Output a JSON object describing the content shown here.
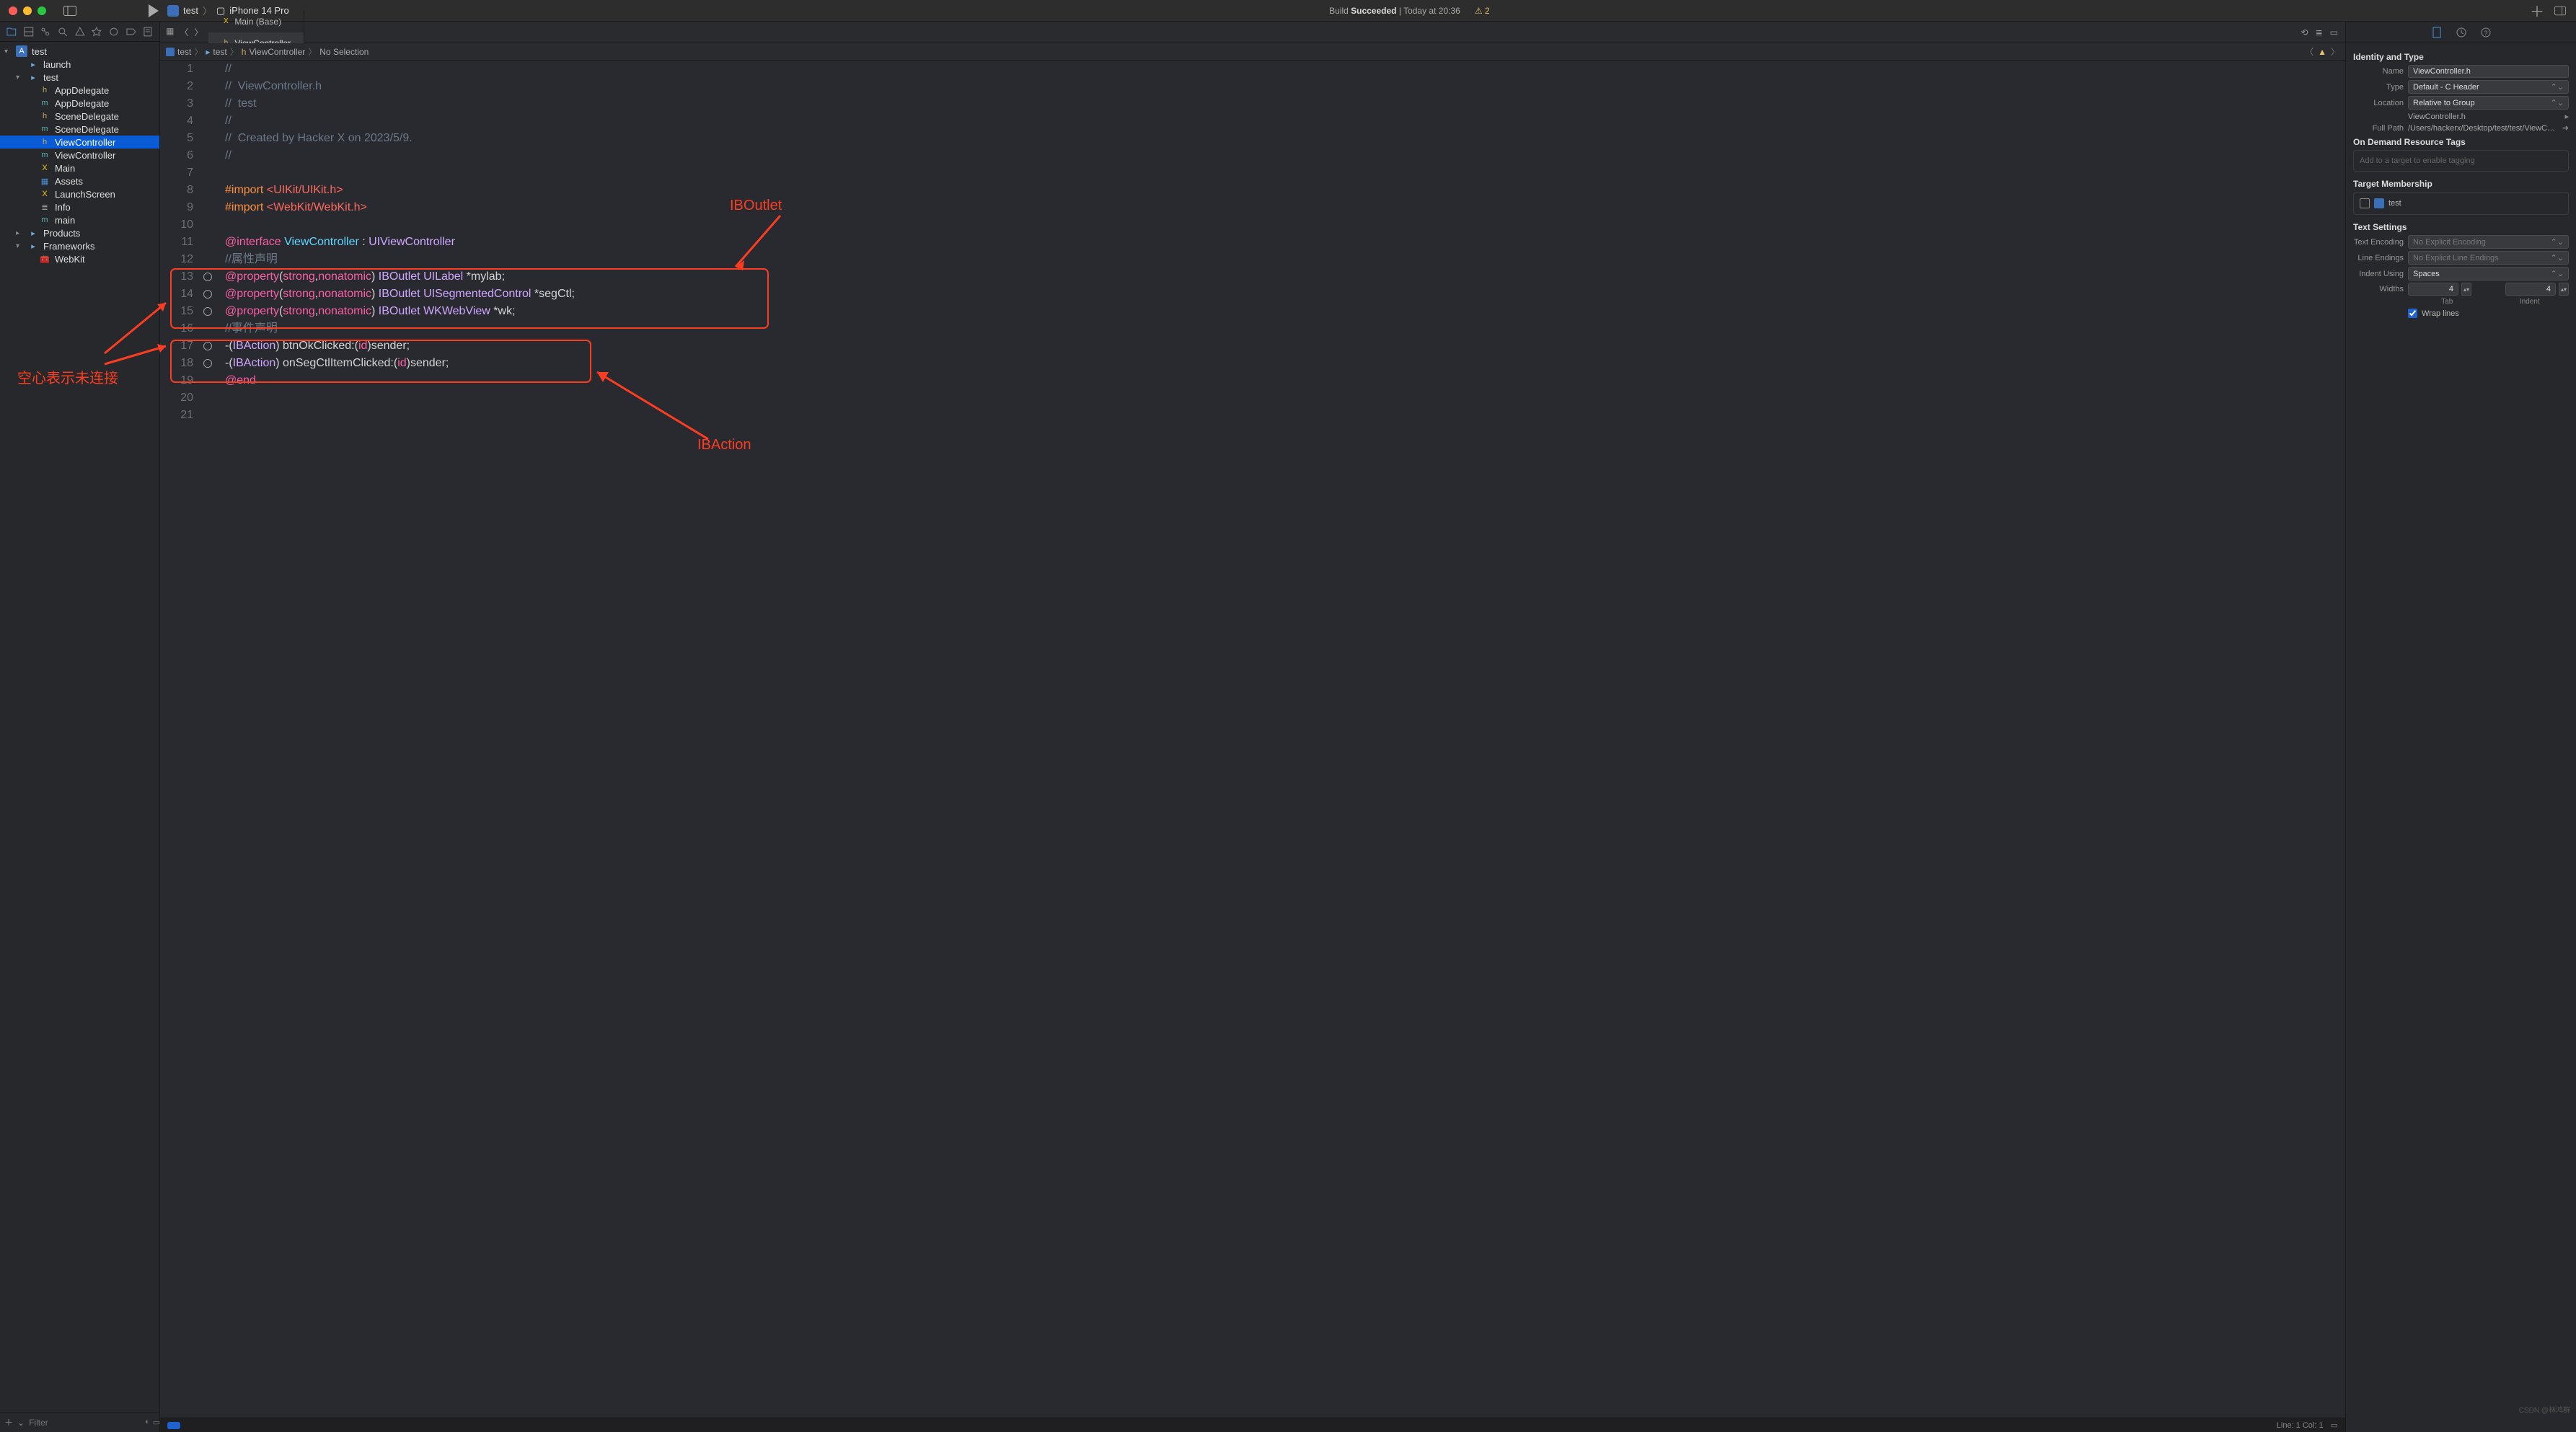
{
  "titlebar": {
    "scheme_app": "test",
    "scheme_device": "iPhone 14 Pro",
    "build_status_prefix": "Build",
    "build_status_result": "Succeeded",
    "build_status_time": "Today at 20:36",
    "warning_count": "2"
  },
  "editor_tabs": [
    {
      "icon": "X",
      "icon_color": "#f0c419",
      "label": "Main (Base)",
      "active": false
    },
    {
      "icon": "h",
      "icon_color": "#c9a66b",
      "label": "ViewController",
      "active": true
    }
  ],
  "jumpbar": {
    "segments": [
      "test",
      "test",
      "ViewController",
      "No Selection"
    ]
  },
  "navigator": {
    "root": {
      "name": "test",
      "icon": "app"
    },
    "items": [
      {
        "d": 1,
        "icon": "folder",
        "name": "launch"
      },
      {
        "d": 1,
        "icon": "folder",
        "name": "test",
        "open": true
      },
      {
        "d": 2,
        "icon": "h",
        "name": "AppDelegate"
      },
      {
        "d": 2,
        "icon": "m",
        "name": "AppDelegate"
      },
      {
        "d": 2,
        "icon": "h",
        "name": "SceneDelegate"
      },
      {
        "d": 2,
        "icon": "m",
        "name": "SceneDelegate"
      },
      {
        "d": 2,
        "icon": "h",
        "name": "ViewController",
        "selected": true
      },
      {
        "d": 2,
        "icon": "m",
        "name": "ViewController"
      },
      {
        "d": 2,
        "icon": "storyboard",
        "name": "Main"
      },
      {
        "d": 2,
        "icon": "assets",
        "name": "Assets"
      },
      {
        "d": 2,
        "icon": "storyboard",
        "name": "LaunchScreen"
      },
      {
        "d": 2,
        "icon": "plist",
        "name": "Info"
      },
      {
        "d": 2,
        "icon": "m",
        "name": "main"
      },
      {
        "d": 1,
        "icon": "folder",
        "name": "Products",
        "closed": true
      },
      {
        "d": 1,
        "icon": "folder",
        "name": "Frameworks",
        "open": true
      },
      {
        "d": 2,
        "icon": "briefcase",
        "name": "WebKit"
      }
    ],
    "filter_placeholder": "Filter"
  },
  "code": {
    "lines": [
      {
        "n": 1,
        "html": "<span class='cm-comment'>//</span>"
      },
      {
        "n": 2,
        "html": "<span class='cm-comment'>//  ViewController.h</span>"
      },
      {
        "n": 3,
        "html": "<span class='cm-comment'>//  test</span>"
      },
      {
        "n": 4,
        "html": "<span class='cm-comment'>//</span>"
      },
      {
        "n": 5,
        "html": "<span class='cm-comment'>//  Created by Hacker X on 2023/5/9.</span>"
      },
      {
        "n": 6,
        "html": "<span class='cm-comment'>//</span>"
      },
      {
        "n": 7,
        "html": ""
      },
      {
        "n": 8,
        "html": "<span class='cm-pre'>#import </span><span class='cm-str'>&lt;UIKit/UIKit.h&gt;</span>"
      },
      {
        "n": 9,
        "html": "<span class='cm-pre'>#import </span><span class='cm-str'>&lt;WebKit/WebKit.h&gt;</span>"
      },
      {
        "n": 10,
        "html": ""
      },
      {
        "n": 11,
        "html": "<span class='cm-kw'>@interface</span> <span class='cm-type'>ViewController</span> : <span class='cm-type2'>UIViewController</span>"
      },
      {
        "n": 12,
        "html": "<span class='cm-comment'>//属性声明</span>"
      },
      {
        "n": 13,
        "conn": true,
        "html": "<span class='cm-kw'>@property</span>(<span class='cm-kw'>strong</span>,<span class='cm-kw'>nonatomic</span>) <span class='cm-attr'>IBOutlet</span> <span class='cm-type2'>UILabel</span> *mylab;"
      },
      {
        "n": 14,
        "conn": true,
        "html": "<span class='cm-kw'>@property</span>(<span class='cm-kw'>strong</span>,<span class='cm-kw'>nonatomic</span>) <span class='cm-attr'>IBOutlet</span> <span class='cm-type2'>UISegmentedControl</span> *segCtl;"
      },
      {
        "n": 15,
        "conn": true,
        "html": "<span class='cm-kw'>@property</span>(<span class='cm-kw'>strong</span>,<span class='cm-kw'>nonatomic</span>) <span class='cm-attr'>IBOutlet</span> <span class='cm-type2'>WKWebView</span> *wk;"
      },
      {
        "n": 16,
        "html": "<span class='cm-comment'>//事件声明</span>"
      },
      {
        "n": 17,
        "conn": true,
        "html": "-(<span class='cm-attr'>IBAction</span>) btnOkClicked:(<span class='cm-id'>id</span>)sender;"
      },
      {
        "n": 18,
        "conn": true,
        "html": "-(<span class='cm-attr'>IBAction</span>) onSegCtlItemClicked:(<span class='cm-id'>id</span>)sender;"
      },
      {
        "n": 19,
        "html": "<span class='cm-kw'>@end</span>"
      },
      {
        "n": 20,
        "html": ""
      },
      {
        "n": 21,
        "html": ""
      }
    ]
  },
  "annotations": {
    "iboutlet_label": "IBOutlet",
    "ibaction_label": "IBAction",
    "left_label": "空心表示未连接"
  },
  "statusbar": {
    "position": "Line: 1  Col: 1"
  },
  "inspector": {
    "section_identity": "Identity and Type",
    "name_label": "Name",
    "name_value": "ViewController.h",
    "type_label": "Type",
    "type_value": "Default - C Header",
    "location_label": "Location",
    "location_value": "Relative to Group",
    "location_file": "ViewController.h",
    "fullpath_label": "Full Path",
    "fullpath_value": "/Users/hackerx/Desktop/test/test/ViewController.h",
    "section_ondemand": "On Demand Resource Tags",
    "ondemand_placeholder": "Add to a target to enable tagging",
    "section_membership": "Target Membership",
    "membership_target": "test",
    "section_textsettings": "Text Settings",
    "textenc_label": "Text Encoding",
    "textenc_value": "No Explicit Encoding",
    "lineend_label": "Line Endings",
    "lineend_value": "No Explicit Line Endings",
    "indent_label": "Indent Using",
    "indent_value": "Spaces",
    "widths_label": "Widths",
    "tab_value": "4",
    "indent_width_value": "4",
    "tab_caption": "Tab",
    "indent_caption": "Indent",
    "wrap_label": "Wrap lines"
  },
  "watermark": "CSDN @林鸿群"
}
